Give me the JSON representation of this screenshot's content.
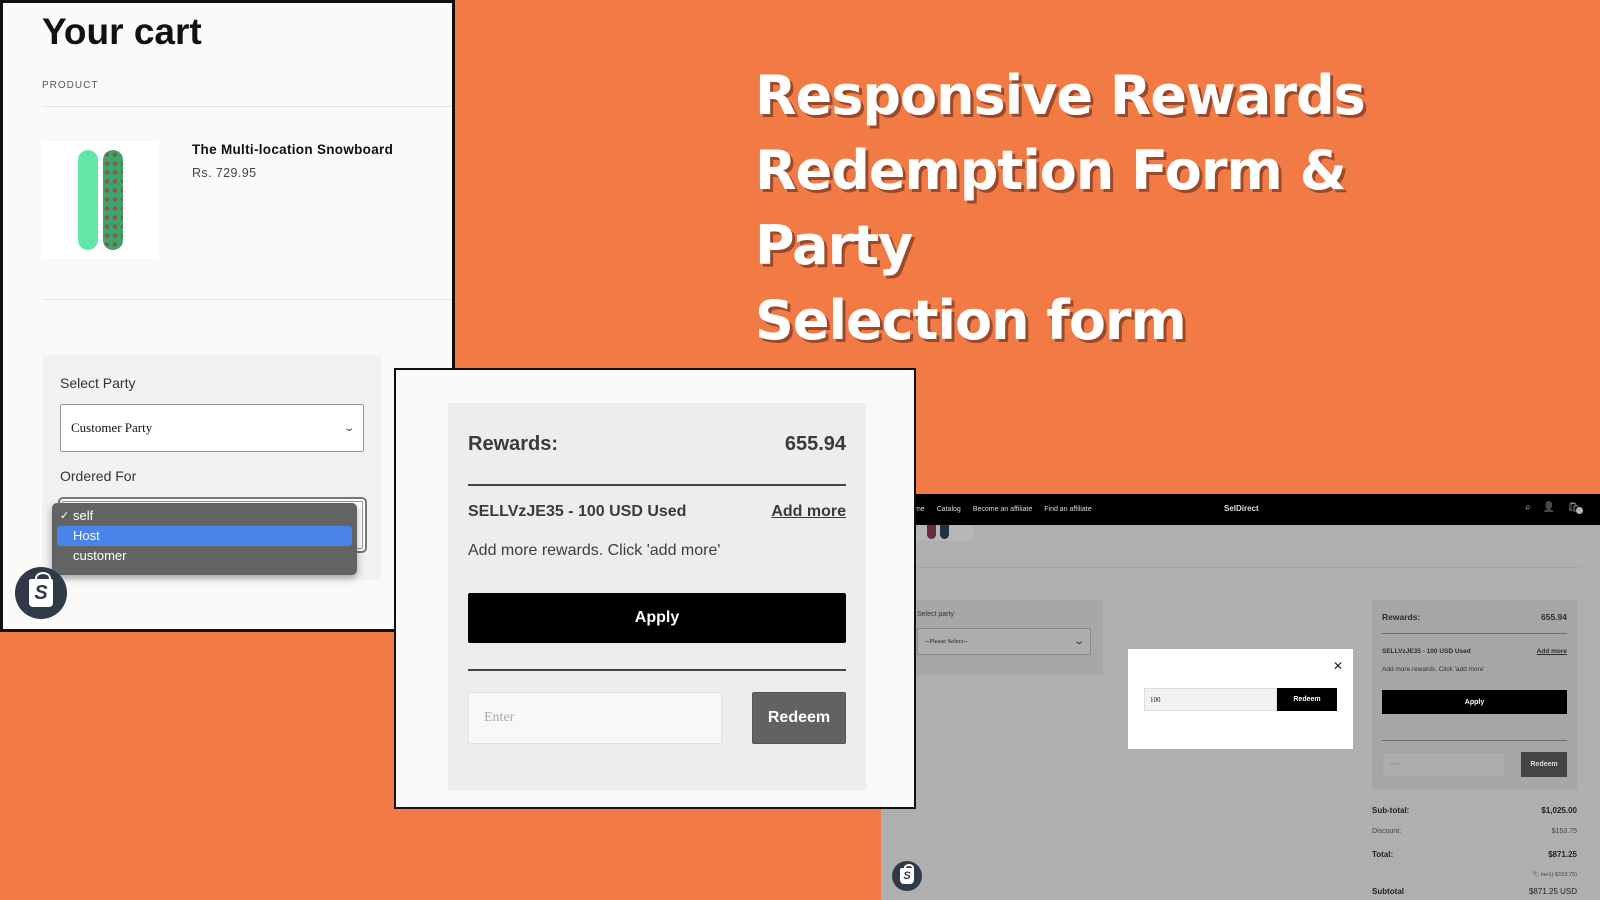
{
  "headline": {
    "lines": [
      "Responsive Rewards",
      "Redemption Form & Party",
      "Selection form"
    ]
  },
  "cart": {
    "title": "Your cart",
    "column_label": "PRODUCT",
    "product": {
      "name": "The Multi-location Snowboard",
      "price": "Rs. 729.95"
    },
    "party_form": {
      "select_party_label": "Select Party",
      "select_party_value": "Customer Party",
      "ordered_for_label": "Ordered For",
      "ordered_for_options": [
        {
          "label": "self",
          "checked": true,
          "highlighted": false
        },
        {
          "label": "Host",
          "checked": false,
          "highlighted": true
        },
        {
          "label": "customer",
          "checked": false,
          "highlighted": false
        }
      ],
      "check_glyph": "✓",
      "chevron_glyph": "⌄"
    }
  },
  "rewards_form": {
    "title": "Rewards:",
    "balance": "655.94",
    "used_code": "SELLVzJE35 - 100 USD Used",
    "add_more_label": "Add more",
    "hint": "Add more rewards. Click 'add more'",
    "apply_label": "Apply",
    "input_placeholder": "Enter",
    "redeem_label": "Redeem"
  },
  "storefront": {
    "nav_links": [
      "Home",
      "Catalog",
      "Become an affiliate",
      "Find an affiliate"
    ],
    "brand": "SelDirect",
    "icons": {
      "search": "⌕",
      "account": "👤",
      "cart": "🛍"
    },
    "select_party_label": "Select party",
    "select_party_value": "--Please Select--",
    "modal": {
      "input_value": "100",
      "redeem_label": "Redeem",
      "close_glyph": "✕"
    },
    "rewards": {
      "title": "Rewards:",
      "balance": "655.94",
      "used_code": "SELLVzJE35 - 100 USD Used",
      "add_more_label": "Add more",
      "hint": "Add more rewards. Click 'add more'",
      "apply_label": "Apply",
      "input_placeholder": "Enter",
      "redeem_label": "Redeem"
    },
    "totals": {
      "subtotal_label": "Sub-total:",
      "subtotal_value": "$1,025.00",
      "discount_label": "Discount:",
      "discount_value": "$153.75",
      "total_label": "Total:",
      "total_value": "$871.25",
      "tier_note": "🏷 tier1(-$153.75)",
      "final_label": "Subtotal",
      "final_value": "$871.25 USD"
    }
  },
  "colors": {
    "background_orange": "#f27a45",
    "highlight_blue": "#4a84e8",
    "dropdown_gray": "#636363",
    "button_black": "#000000",
    "redeem_gray": "#626262"
  }
}
